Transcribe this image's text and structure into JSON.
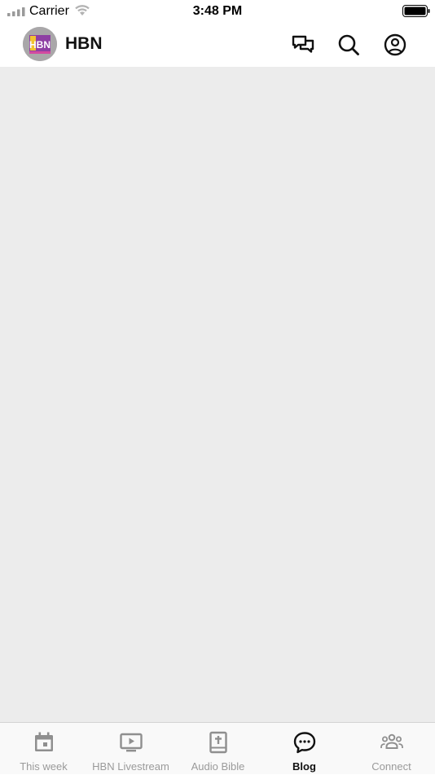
{
  "status_bar": {
    "carrier": "Carrier",
    "time": "3:48 PM"
  },
  "header": {
    "title": "HBN",
    "logo_text": "HBN",
    "icons": [
      "chat-icon",
      "search-icon",
      "profile-icon"
    ]
  },
  "tabs": [
    {
      "label": "This week",
      "icon": "calendar-icon",
      "active": false
    },
    {
      "label": "HBN Livestream",
      "icon": "tv-play-icon",
      "active": false
    },
    {
      "label": "Audio Bible",
      "icon": "bible-icon",
      "active": false
    },
    {
      "label": "Blog",
      "icon": "blog-chat-icon",
      "active": true
    },
    {
      "label": "Connect",
      "icon": "group-icon",
      "active": false
    }
  ],
  "colors": {
    "content_bg": "#ececec",
    "tab_active": "#111111",
    "tab_inactive": "#9a9a9a"
  }
}
